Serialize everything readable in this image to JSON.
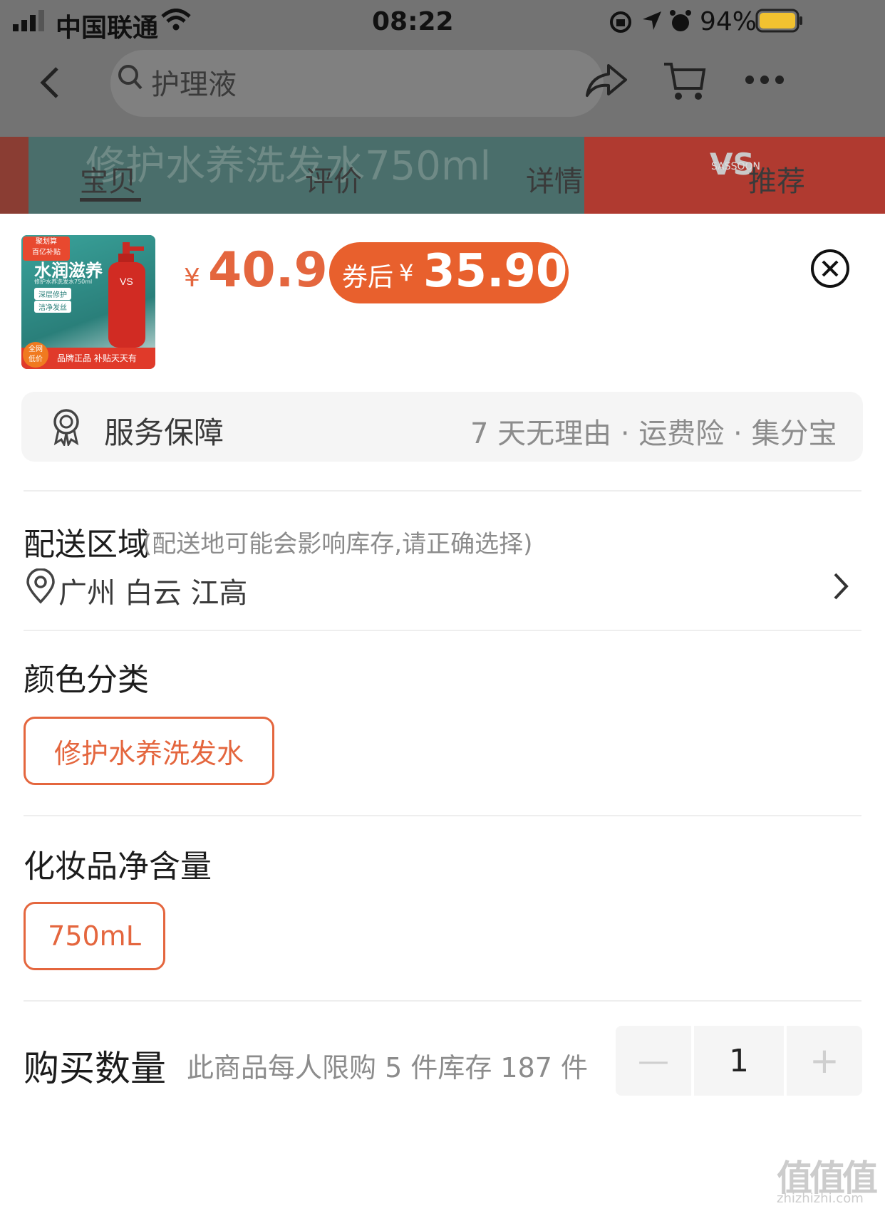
{
  "status_bar": {
    "carrier": "中国联通",
    "time": "08:22",
    "battery": "94%"
  },
  "header": {
    "search_placeholder": "护理液"
  },
  "tabs": [
    "宝贝",
    "评价",
    "详情",
    "推荐"
  ],
  "banner_text": "修护水养洗发水750ml",
  "product": {
    "price_symbol": "¥",
    "price": "40.9",
    "coupon_label": "券后",
    "coupon_symbol": "¥",
    "coupon_price": "35.90",
    "thumbnail": {
      "badge_top": "聚划算",
      "badge_sub": "百亿补贴",
      "headline": "水润滋养",
      "subline": "修护水养洗发水750ml",
      "tag1": "深层修护",
      "tag2": "洁净发丝",
      "footer_badge_top": "全网",
      "footer_badge_bottom": "低价",
      "footer_text": "品牌正品 补贴天天有"
    }
  },
  "service": {
    "label": "服务保障",
    "items": "7 天无理由 · 运费险 · 集分宝"
  },
  "delivery": {
    "title": "配送区域",
    "hint": "(配送地可能会影响库存,请正确选择)",
    "location": "广州 白云 江高"
  },
  "color": {
    "title": "颜色分类",
    "option": "修护水养洗发水"
  },
  "volume": {
    "title": "化妆品净含量",
    "option": "750mL"
  },
  "quantity": {
    "title": "购买数量",
    "hint": "此商品每人限购 5 件库存 187 件",
    "value": "1",
    "minus": "—",
    "plus": "+"
  },
  "watermark": {
    "logo": "值值值",
    "url": "zhizhizhi.com"
  },
  "colors": {
    "accent": "#e4663e",
    "coupon_bg": "#e8602d"
  }
}
